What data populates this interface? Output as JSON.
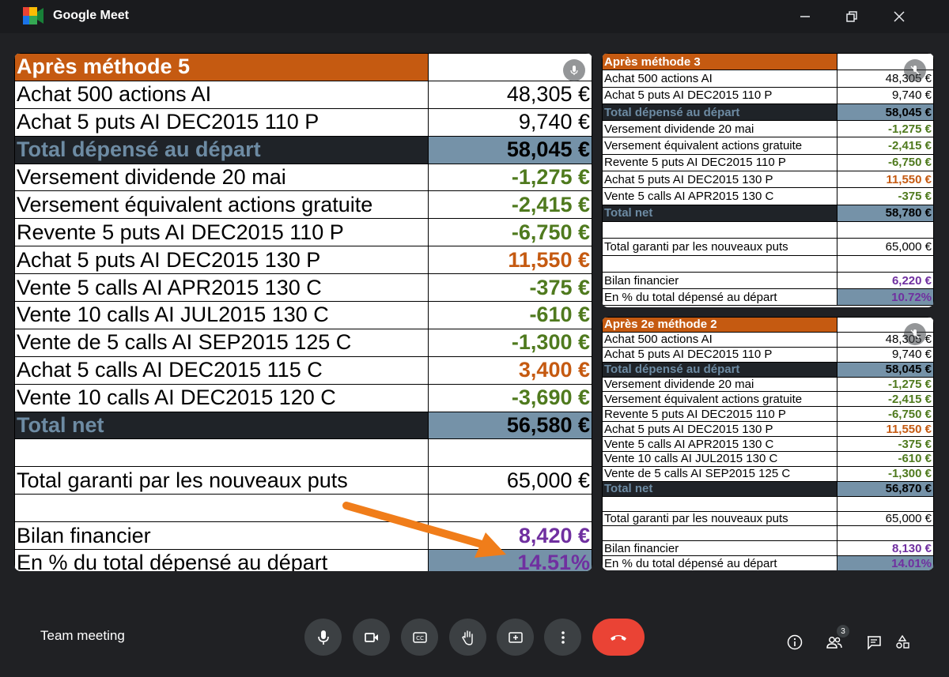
{
  "window": {
    "title": "Google Meet"
  },
  "meeting": {
    "name": "Team meeting",
    "participants_badge": "3"
  },
  "colors": {
    "accent_orange": "#c55a11",
    "hangup": "#ea4335",
    "purple": "#7030a0"
  },
  "main_sheet": {
    "title": "Après méthode 5",
    "rows": [
      {
        "label": "Achat 500 actions AI",
        "value": "48,305 €",
        "style": "normal"
      },
      {
        "label": "Achat 5 puts AI DEC2015 110 P",
        "value": "9,740 €",
        "style": "normal"
      },
      {
        "label": "Total dépensé au départ",
        "value": "58,045 €",
        "style": "dark"
      },
      {
        "label": "Versement dividende 20 mai",
        "value": "-1,275 €",
        "style": "neg"
      },
      {
        "label": "Versement équivalent actions gratuite",
        "value": "-2,415 €",
        "style": "neg"
      },
      {
        "label": "Revente 5 puts AI DEC2015 110 P",
        "value": "-6,750 €",
        "style": "neg"
      },
      {
        "label": "Achat 5 puts AI DEC2015 130 P",
        "value": "11,550 €",
        "style": "orange"
      },
      {
        "label": "Vente 5 calls AI APR2015 130 C",
        "value": "-375 €",
        "style": "neg"
      },
      {
        "label": "Vente 10 calls AI JUL2015 130 C",
        "value": "-610 €",
        "style": "neg"
      },
      {
        "label": "Vente de 5 calls AI SEP2015 125 C",
        "value": "-1,300 €",
        "style": "neg"
      },
      {
        "label": "Achat 5 calls AI DEC2015 115 C",
        "value": "3,400 €",
        "style": "orange"
      },
      {
        "label": "Vente 10 calls AI DEC2015 120 C",
        "value": "-3,690 €",
        "style": "neg"
      },
      {
        "label": "Total net",
        "value": "56,580 €",
        "style": "dark"
      },
      {
        "label": "",
        "value": "",
        "style": "blank"
      },
      {
        "label": "Total garanti par les nouveaux puts",
        "value": "65,000 €",
        "style": "normal"
      },
      {
        "label": "",
        "value": "",
        "style": "blank"
      },
      {
        "label": "Bilan financier",
        "value": "8,420 €",
        "style": "purple"
      },
      {
        "label": "En % du total dépensé au départ",
        "value": "14.51%",
        "style": "pct"
      }
    ]
  },
  "sheet_m3": {
    "title": "Après méthode 3",
    "rows": [
      {
        "label": "Achat 500 actions AI",
        "value": "48,305 €",
        "style": "normal"
      },
      {
        "label": "Achat 5 puts AI DEC2015 110 P",
        "value": "9,740 €",
        "style": "normal"
      },
      {
        "label": "Total dépensé au départ",
        "value": "58,045 €",
        "style": "dark"
      },
      {
        "label": "Versement dividende 20 mai",
        "value": "-1,275 €",
        "style": "neg"
      },
      {
        "label": "Versement équivalent actions gratuite",
        "value": "-2,415 €",
        "style": "neg"
      },
      {
        "label": "Revente 5 puts AI DEC2015 110 P",
        "value": "-6,750 €",
        "style": "neg"
      },
      {
        "label": "Achat 5 puts AI DEC2015 130 P",
        "value": "11,550 €",
        "style": "orange"
      },
      {
        "label": "Vente 5 calls AI APR2015 130 C",
        "value": "-375 €",
        "style": "neg"
      },
      {
        "label": "Total net",
        "value": "58,780 €",
        "style": "dark"
      },
      {
        "label": "",
        "value": "",
        "style": "blank"
      },
      {
        "label": "Total garanti par les nouveaux puts",
        "value": "65,000 €",
        "style": "normal"
      },
      {
        "label": "",
        "value": "",
        "style": "blank"
      },
      {
        "label": "Bilan financier",
        "value": "6,220 €",
        "style": "purple"
      },
      {
        "label": "En % du total dépensé au départ",
        "value": "10.72%",
        "style": "pct"
      }
    ]
  },
  "sheet_m2": {
    "title": "Après 2e méthode 2",
    "rows": [
      {
        "label": "Achat 500 actions AI",
        "value": "48,305 €",
        "style": "normal"
      },
      {
        "label": "Achat 5 puts AI DEC2015 110 P",
        "value": "9,740 €",
        "style": "normal"
      },
      {
        "label": "Total dépensé au départ",
        "value": "58,045 €",
        "style": "dark"
      },
      {
        "label": "Versement dividende 20 mai",
        "value": "-1,275 €",
        "style": "neg"
      },
      {
        "label": "Versement équivalent actions gratuite",
        "value": "-2,415 €",
        "style": "neg"
      },
      {
        "label": "Revente 5 puts AI DEC2015 110 P",
        "value": "-6,750 €",
        "style": "neg"
      },
      {
        "label": "Achat 5 puts AI DEC2015 130 P",
        "value": "11,550 €",
        "style": "orange"
      },
      {
        "label": "Vente 5 calls AI APR2015 130 C",
        "value": "-375 €",
        "style": "neg"
      },
      {
        "label": "Vente 10 calls AI JUL2015 130 C",
        "value": "-610 €",
        "style": "neg"
      },
      {
        "label": "Vente de 5 calls AI SEP2015 125 C",
        "value": "-1,300 €",
        "style": "neg"
      },
      {
        "label": "Total net",
        "value": "56,870 €",
        "style": "dark"
      },
      {
        "label": "",
        "value": "",
        "style": "blank"
      },
      {
        "label": "Total garanti par les nouveaux puts",
        "value": "65,000 €",
        "style": "normal"
      },
      {
        "label": "",
        "value": "",
        "style": "blank"
      },
      {
        "label": "Bilan financier",
        "value": "8,130 €",
        "style": "purple"
      },
      {
        "label": "En % du total dépensé au départ",
        "value": "14.01%",
        "style": "pct"
      }
    ]
  },
  "controls": {
    "mic": "microphone-icon",
    "camera": "camera-icon",
    "captions": "captions-icon",
    "hand": "raise-hand-icon",
    "present": "present-icon",
    "more": "more-options-icon",
    "hangup": "hang-up-icon",
    "info": "info-icon",
    "people": "people-icon",
    "chat": "chat-icon",
    "activities": "activities-icon"
  }
}
